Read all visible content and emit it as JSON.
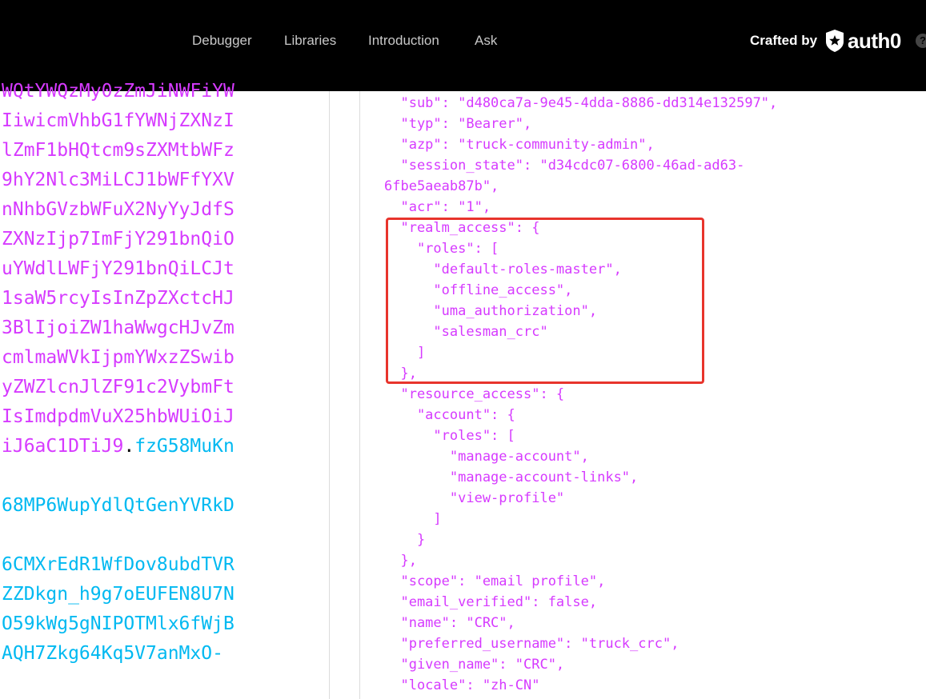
{
  "nav": {
    "links": [
      "Debugger",
      "Libraries",
      "Introduction",
      "Ask"
    ],
    "crafted_by": "Crafted by",
    "brand": "auth0",
    "help": "?"
  },
  "encoded": {
    "payload_lines": [
      "WQtYWQzMy0zZmJiNWFiYW",
      "IiwicmVhbG1fYWNjZXNzI",
      "lZmF1bHQtcm9sZXMtbWFz",
      "9hY2Nlc3MiLCJ1bWFfYXV",
      "nNhbGVzbWFuX2NyYyJdfS",
      "ZXNzIjp7ImFjY291bnQiO",
      "uYWdlLWFjY291bnQiLCJt",
      "1saW5rcyIsInZpZXctcHJ",
      "3BlIjoiZW1haWwgcHJvZm",
      "cmlmaWVkIjpmYWxzZSwib",
      "yZWZlcnJlZF91c2VybmFt",
      "IsImdpdmVuX25hbWUiOiJ"
    ],
    "last_payload": "iJ6aC1DTiJ9",
    "dot": ".",
    "sig_start": "fzG58MuKn",
    "sig_lines": [
      "68MP6WupYdlQtGenYVRkD",
      "6CMXrEdR1WfDov8ubdTVR",
      "ZZDkgn_h9g7oEUFEN8U7N",
      "O59kWg5gNIPOTMlx6fWjB",
      "AQH7Zkg64Kq5V7anMxO-"
    ]
  },
  "json_lines": [
    "  \"sub\": \"d480ca7a-9e45-4dda-8886-dd314e132597\",",
    "  \"typ\": \"Bearer\",",
    "  \"azp\": \"truck-community-admin\",",
    "  \"session_state\": \"d34cdc07-6800-46ad-ad63-",
    "6fbe5aeab87b\",",
    "  \"acr\": \"1\",",
    "  \"realm_access\": {",
    "    \"roles\": [",
    "      \"default-roles-master\",",
    "      \"offline_access\",",
    "      \"uma_authorization\",",
    "      \"salesman_crc\"",
    "    ]",
    "  },",
    "  \"resource_access\": {",
    "    \"account\": {",
    "      \"roles\": [",
    "        \"manage-account\",",
    "        \"manage-account-links\",",
    "        \"view-profile\"",
    "      ]",
    "    }",
    "  },",
    "  \"scope\": \"email profile\",",
    "  \"email_verified\": false,",
    "  \"name\": \"CRC\",",
    "  \"preferred_username\": \"truck_crc\",",
    "  \"given_name\": \"CRC\",",
    "  \"locale\": \"zh-CN\""
  ],
  "colors": {
    "payload": "#d63aff",
    "signature": "#00b9f1",
    "highlight": "#e8342c"
  }
}
